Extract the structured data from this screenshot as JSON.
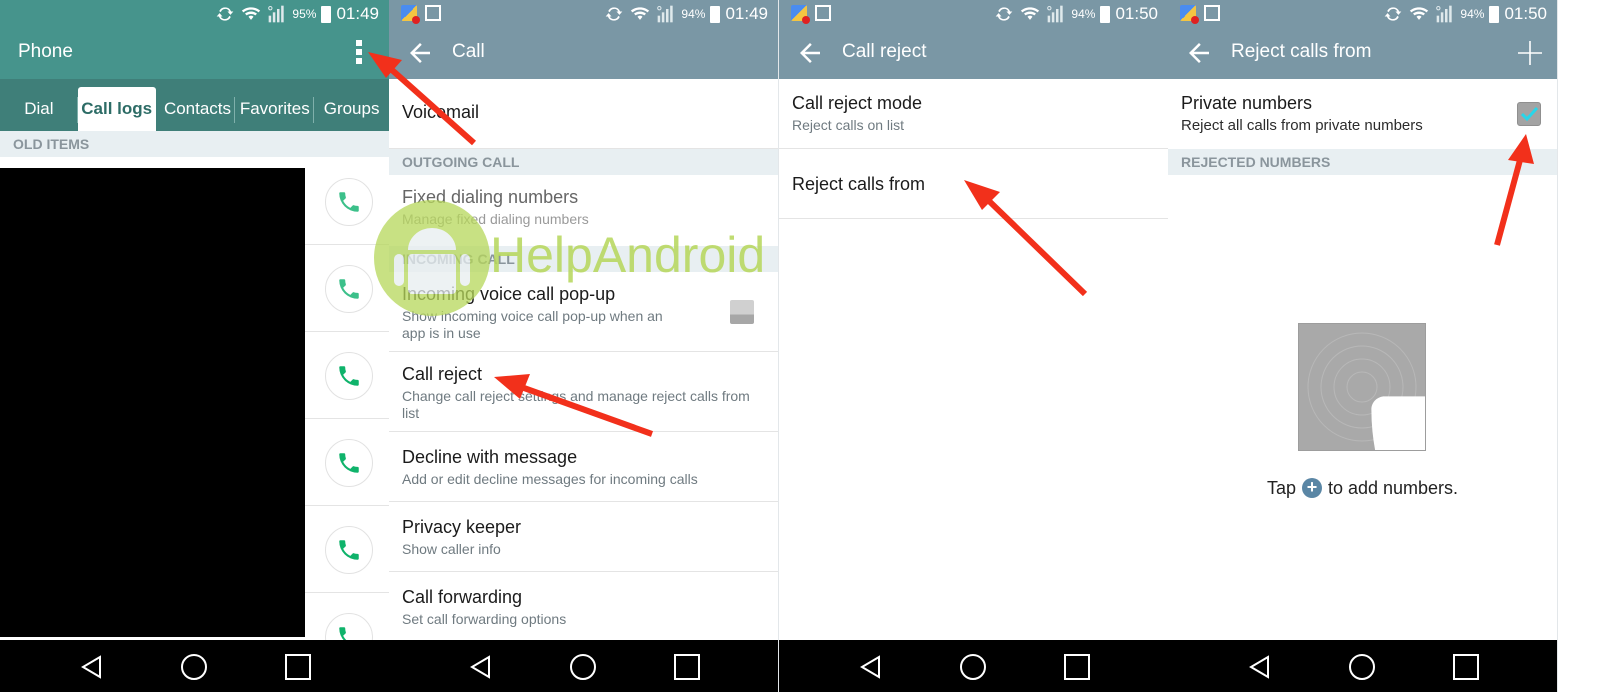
{
  "panels": [
    {
      "status": {
        "battery_pct": "95%",
        "time": "01:49"
      },
      "appbar": {
        "title": "Phone",
        "overflow_icon": "more-vert-icon"
      },
      "tabs": [
        {
          "label": "Dial",
          "active": false
        },
        {
          "label": "Call logs",
          "active": true
        },
        {
          "label": "Contacts",
          "active": false
        },
        {
          "label": "Favorites",
          "active": false
        },
        {
          "label": "Groups",
          "active": false
        }
      ],
      "section": "OLD ITEMS",
      "call_log_entries": 6
    },
    {
      "status": {
        "battery_pct": "94%",
        "time": "01:49"
      },
      "appbar": {
        "title": "Call"
      },
      "items": [
        {
          "title": "Voicemail"
        },
        {
          "section": "OUTGOING CALL"
        },
        {
          "title": "Fixed dialing numbers",
          "subtitle": "Manage fixed dialing numbers"
        },
        {
          "section": "INCOMING CALL"
        },
        {
          "title": "Incoming voice call pop-up",
          "subtitle": "Show incoming voice call pop-up when an app is in use",
          "toggle": false
        },
        {
          "title": "Call reject",
          "subtitle": "Change call reject settings and manage reject calls from list"
        },
        {
          "title": "Decline with message",
          "subtitle": "Add or edit decline messages for incoming calls"
        },
        {
          "title": "Privacy keeper",
          "subtitle": "Show caller info"
        },
        {
          "title": "Call forwarding",
          "subtitle": "Set call forwarding options"
        }
      ]
    },
    {
      "status": {
        "battery_pct": "94%",
        "time": "01:50"
      },
      "appbar": {
        "title": "Call reject"
      },
      "items": [
        {
          "title": "Call reject mode",
          "subtitle": "Reject calls on list"
        },
        {
          "title": "Reject calls from"
        }
      ]
    },
    {
      "status": {
        "battery_pct": "94%",
        "time": "01:50"
      },
      "appbar": {
        "title": "Reject calls from",
        "action_icon": "plus-icon"
      },
      "private_numbers": {
        "title": "Private numbers",
        "subtitle": "Reject all calls from private numbers",
        "checked": true
      },
      "section": "REJECTED NUMBERS",
      "empty": {
        "prefix": "Tap",
        "suffix": "to add numbers.",
        "plus": "+"
      }
    }
  ],
  "watermark": "HelpAndroid",
  "colors": {
    "teal_bar": "#46948c",
    "teal_tabs": "#3f7f79",
    "slate_bar": "#7a97a5",
    "arrow": "#f2301b",
    "check": "#27d6ea",
    "call_green": "#0fb36b"
  }
}
